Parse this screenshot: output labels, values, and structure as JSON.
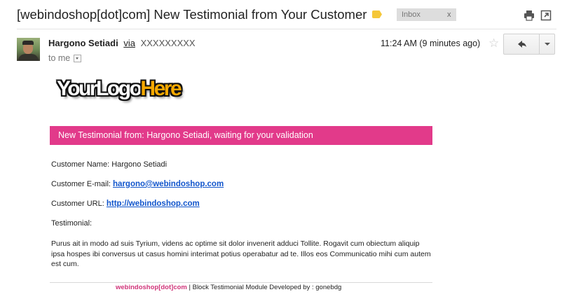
{
  "header": {
    "subject": "[webindoshop[dot]com] New Testimonial from Your Customer",
    "label_color": "#f5c739",
    "inbox_label": "Inbox",
    "inbox_remove": "x",
    "print_icon": "print-icon",
    "newwindow_icon": "new-window-icon"
  },
  "message": {
    "sender_name": "Hargono Setiadi",
    "via_label": "via",
    "via_address": "XXXXXXXXX",
    "to_label": "to me",
    "timestamp": "11:24 AM (9 minutes ago)",
    "star_icon": "star-icon",
    "reply_icon": "reply-icon",
    "more_icon": "chevron-down-icon"
  },
  "email": {
    "logo_part1": "YourLogo",
    "logo_part2": "Here",
    "banner_text": "New Testimonial from: Hargono Setiadi, waiting for your validation",
    "banner_color": "#e23a8a",
    "customer_name_label": "Customer Name:",
    "customer_name": "Hargono Setiadi",
    "customer_email_label": "Customer E-mail:",
    "customer_email": "hargono@webindoshop.com",
    "customer_url_label": "Customer URL:",
    "customer_url": "http://webindoshop.com",
    "testimonial_label": "Testimonial:",
    "testimonial_text": "Purus ait in modo ad suis Tyrium, videns ac optime sit dolor invenerit adduci Tollite. Rogavit cum obiectum aliquip ipsa hospes ibi conversus ut casus homini interimat potius operabatur ad te. Illos eos Communicatio mihi cum autem est cum.",
    "footer_brand": "webindoshop[dot]com",
    "footer_text": " | Block Testimonial Module Developed by : gonebdg"
  }
}
